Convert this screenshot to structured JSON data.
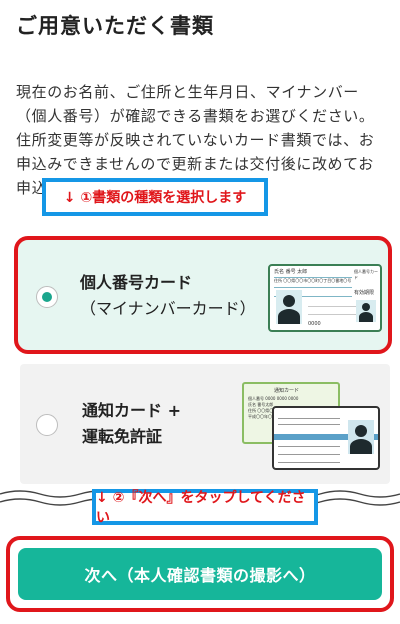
{
  "page": {
    "title": "ご用意いただく書類"
  },
  "description": {
    "line1": "現在のお名前、ご住所と生年月日、マイナンバー（個人番号）が確認できる書類をお選びください。",
    "line2": "住所変更等が反映されていないカード書類では、お申込みできませんので更新または交付後に改めてお申込みください。"
  },
  "annotations": {
    "step1": "↓ ①書類の種類を選択します",
    "step2": "↓ ②『次へ』をタップしてください"
  },
  "options": [
    {
      "main": "個人番号カード",
      "sub": "（マイナンバーカード）",
      "selected": true
    },
    {
      "main": "通知カード +",
      "sub": "運転免許証",
      "selected": false
    }
  ],
  "card_mynumber": {
    "name": "氏名 番号 太郎",
    "address": "住所 〇〇県〇〇市〇〇町〇丁目〇番地〇号",
    "type": "個人番号カード",
    "expiry": "有効期限",
    "number": "0000"
  },
  "card_notice": {
    "title": "通知カード",
    "number_label": "個人番号",
    "number": "0000 0000 0000",
    "name_label": "氏名",
    "name": "番号太郎",
    "address_label": "住所",
    "address": "〇〇県〇〇市〇〇町〇丁目〇番地〇号",
    "birth": "平成〇〇年〇月〇日生"
  },
  "card_license": {
    "title": "運転免許証"
  },
  "next_button": {
    "label": "次へ（本人確認書類の撮影へ）"
  },
  "colors": {
    "accent": "#16b69a",
    "highlight_red": "#e0161b",
    "banner_blue": "#1597e6",
    "selected_bg": "#e6f6f1",
    "unselected_bg": "#f2f2f2"
  }
}
